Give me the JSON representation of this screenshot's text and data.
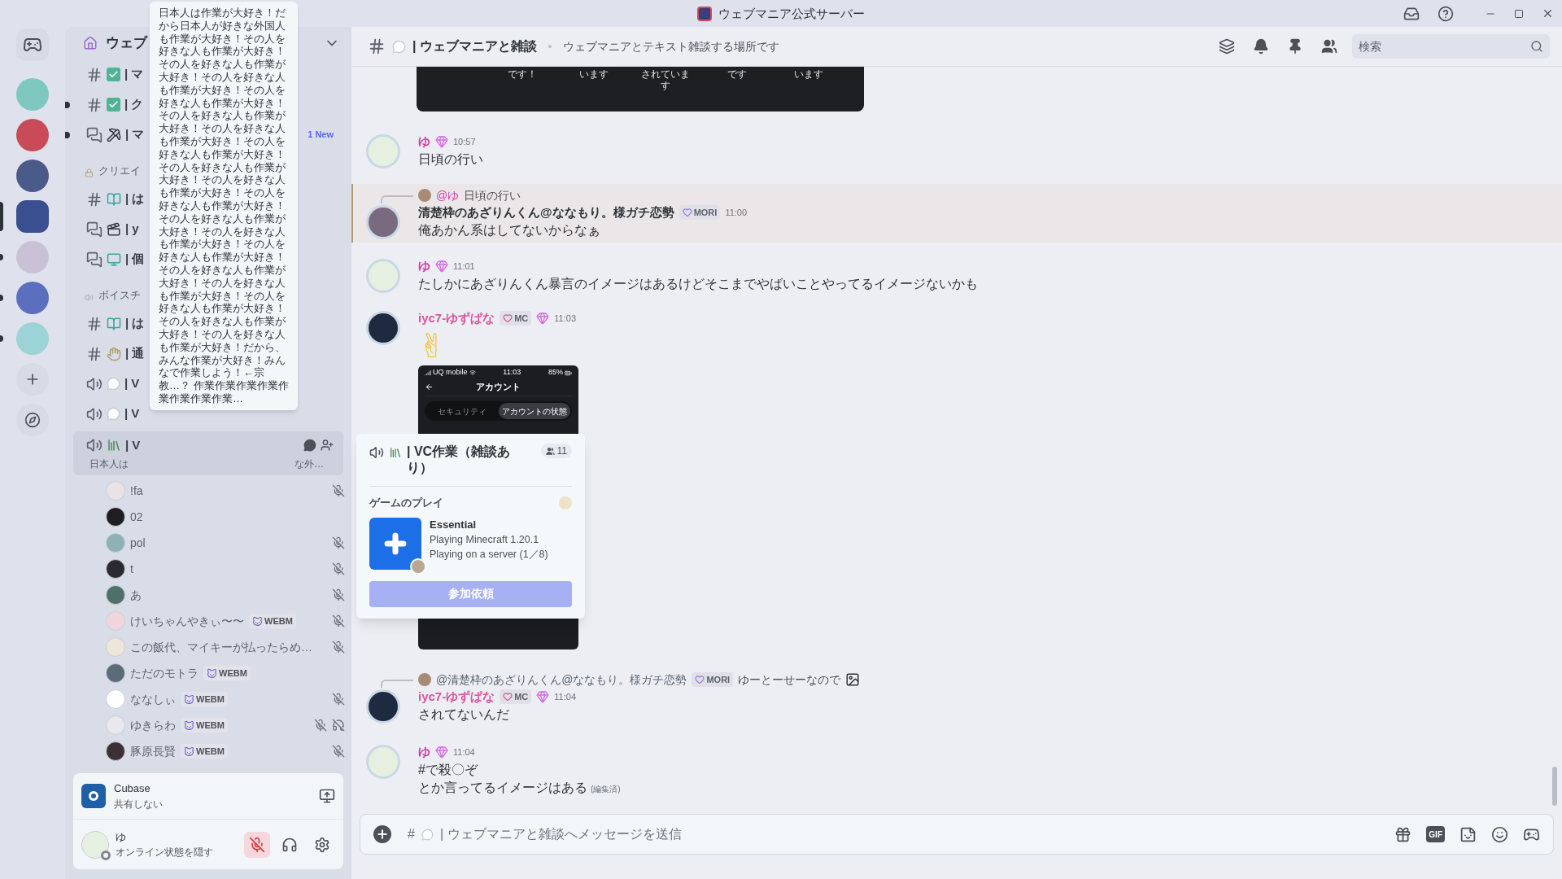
{
  "window": {
    "title": "ウェブマニア公式サーバー"
  },
  "servers": [
    {
      "selected": false,
      "unread": false
    },
    {
      "selected": false,
      "unread": false
    },
    {
      "selected": false,
      "unread": false
    },
    {
      "selected": true,
      "unread": false
    },
    {
      "selected": false,
      "unread": true
    },
    {
      "selected": false,
      "unread": true
    },
    {
      "selected": false,
      "unread": true
    }
  ],
  "sidebar": {
    "server_name": "ウェブ",
    "channels": [
      {
        "kind": "text",
        "label": "| マ",
        "selected": false,
        "unread": false
      },
      {
        "kind": "text",
        "label": "| ク",
        "selected": false,
        "unread": true
      },
      {
        "kind": "forum",
        "label": "| マ",
        "selected": false,
        "unread": true,
        "badge": "1 New"
      },
      {
        "kind": "category",
        "label": "クリエイ"
      },
      {
        "kind": "text",
        "label": "| は",
        "selected": false,
        "unread": false
      },
      {
        "kind": "forum",
        "label": "| y",
        "selected": false,
        "unread": false
      },
      {
        "kind": "forum",
        "label": "| 個",
        "selected": false,
        "unread": false
      },
      {
        "kind": "category",
        "label": "ボイスチ"
      },
      {
        "kind": "text",
        "label": "| は",
        "selected": false,
        "unread": false
      },
      {
        "kind": "text",
        "label": "| 通",
        "selected": false,
        "unread": false
      },
      {
        "kind": "voice",
        "label": "| V",
        "selected": false,
        "unread": false
      },
      {
        "kind": "voice",
        "label": "| V",
        "selected": false,
        "unread": false
      },
      {
        "kind": "voice",
        "label": "| V",
        "selected": true,
        "unread": false,
        "subtitle_parts": [
          "日本人は",
          "な外…"
        ],
        "users": [
          {
            "name": "!fa",
            "muted": true,
            "deafened": false
          },
          {
            "name": "02",
            "muted": false,
            "deafened": false
          },
          {
            "name": "pol",
            "muted": true,
            "deafened": false
          },
          {
            "name": "t",
            "muted": true,
            "deafened": false
          },
          {
            "name": "あ",
            "muted": true,
            "deafened": false
          },
          {
            "name": "けいちゃんやきぃ〜〜",
            "badge": "WEBM",
            "muted": true,
            "deafened": false
          },
          {
            "name": "この飯代、マイキーが払ったらめ…",
            "muted": true,
            "deafened": false
          },
          {
            "name": "ただのモトラ",
            "badge": "WEBM",
            "muted": false,
            "deafened": false
          },
          {
            "name": "ななしぃ",
            "badge": "WEBM",
            "muted": true,
            "deafened": false
          },
          {
            "name": "ゆきらわ",
            "badge": "WEBM",
            "muted": true,
            "deafened": true
          },
          {
            "name": "豚原長賢",
            "badge": "WEBM",
            "muted": true,
            "deafened": false
          }
        ]
      }
    ],
    "activity": {
      "app": "Cubase",
      "status": "共有しない"
    },
    "user": {
      "name": "ゆ",
      "status": "オンライン状態を隠す",
      "mic_muted": true
    }
  },
  "tooltip": {
    "text": "日本人は作業が大好き！だから日本人が好きな外国人も作業が大好き！その人を好きな人も作業が大好き！その人を好きな人も作業が大好き！その人を好きな人も作業が大好き！その人を好きな人も作業が大好き！その人を好きな人も作業が大好き！その人を好きな人も作業が大好き！その人を好きな人も作業が大好き！その人を好きな人も作業が大好き！その人を好きな人も作業が大好き！その人を好きな人も作業が大好き！その人を好きな人も作業が大好き！その人を好きな人も作業が大好き！その人を好きな人も作業が大好き！その人を好きな人も作業が大好き！その人を好きな人も作業が大好き！その人を好きな人も作業が大好き！その人を好きな人も作業が大好き！その人を好きな人も作業が大好き！だから、みんな作業が大好き！みんなで作業しよう！←宗教…？ 作業作業作業作業作業作業作業作業…"
  },
  "channel_header": {
    "name": "| ウェブマニアと雑談",
    "topic": "ウェブマニアとテキスト雑談する場所です",
    "search": {
      "placeholder": "検索"
    }
  },
  "messages": [
    {
      "kind": "embed_tail",
      "labels": [
        "です！",
        "います",
        "されています",
        "です",
        "います"
      ]
    },
    {
      "kind": "message",
      "author": {
        "name": "ゆ",
        "color": "#d03ea6"
      },
      "gem": true,
      "time": "10:57",
      "highlighted": false,
      "lines": [
        "日頃の行い"
      ]
    },
    {
      "kind": "message",
      "reply": {
        "author": "@ゆ",
        "color": "#d03ea6",
        "text": "日頃の行い",
        "has_image": false
      },
      "author": {
        "name": "清楚枠のあざりんくん@ななもり。様ガチ恋勢",
        "color": "#2e3338"
      },
      "badge": {
        "label": "MORI",
        "color": "#9b7be0"
      },
      "gem": false,
      "time": "11:00",
      "highlighted": true,
      "lines": [
        "俺あかん系はしてないからなぁ"
      ]
    },
    {
      "kind": "message",
      "author": {
        "name": "ゆ",
        "color": "#d03ea6"
      },
      "gem": true,
      "time": "11:01",
      "highlighted": false,
      "lines": [
        "たしかにあざりんくん暴言のイメージはあるけどそこまでやばいことやってるイメージないかも"
      ]
    },
    {
      "kind": "message",
      "author": {
        "name": "iyc7-ゆずぱな",
        "color": "#d9559b"
      },
      "badge": {
        "label": "MC",
        "color": "#e0559b"
      },
      "gem": true,
      "time": "11:03",
      "highlighted": false,
      "emoji": "✌",
      "attachment": {
        "carrier": "UQ mobile",
        "clock": "11:03",
        "battery": "85%",
        "title": "アカウント",
        "tabs": [
          {
            "label": "セキュリティ",
            "selected": false
          },
          {
            "label": "アカウントの状態",
            "selected": true
          }
        ]
      }
    },
    {
      "kind": "message",
      "reply": {
        "author": "@清楚枠のあざりんくん@ななもり。様ガチ恋勢",
        "color": "#5c6370",
        "badge": {
          "label": "MORI",
          "color": "#9b7be0"
        },
        "text": "ゆーとーせーなので",
        "has_image": true
      },
      "author": {
        "name": "iyc7-ゆずぱな",
        "color": "#d9559b"
      },
      "badge": {
        "label": "MC",
        "color": "#e0559b"
      },
      "gem": true,
      "time": "11:04",
      "highlighted": false,
      "lines": [
        "されてないんだ"
      ]
    },
    {
      "kind": "message",
      "author": {
        "name": "ゆ",
        "color": "#d03ea6"
      },
      "gem": true,
      "time": "11:04",
      "highlighted": false,
      "lines": [
        "#で殺〇ぞ",
        "とか言ってるイメージはある"
      ],
      "edited": "(編集済)"
    }
  ],
  "popup": {
    "title": "| VC作業（雑談あり）",
    "count": "11",
    "section": "ゲームのプレイ",
    "game": {
      "name": "Essential",
      "details": [
        "Playing Minecraft 1.20.1",
        "Playing on a server (1／8)"
      ]
    },
    "button": {
      "label": "参加依頼",
      "disabled": true
    }
  },
  "composer": {
    "prefix": "#",
    "placeholder": "| ウェブマニアと雑談へメッセージを送信",
    "gif_label": "GIF"
  }
}
